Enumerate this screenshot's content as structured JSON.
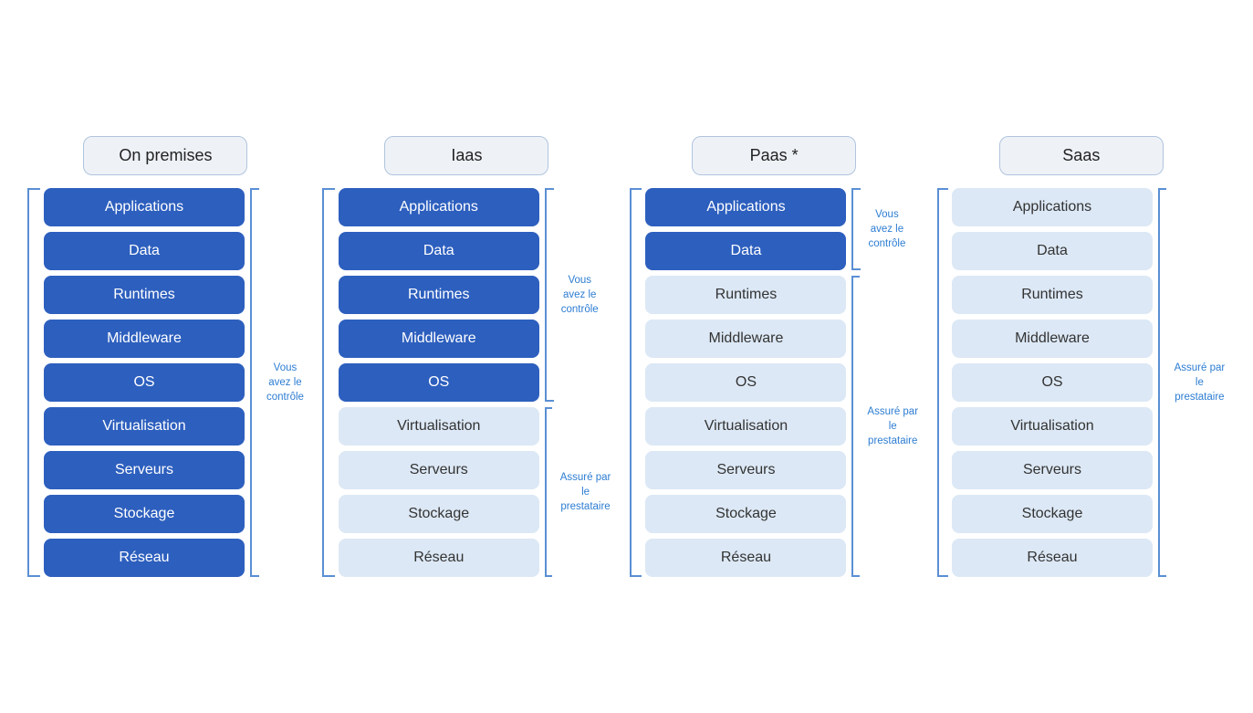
{
  "columns": [
    {
      "id": "on-premises",
      "header": "On premises",
      "items": [
        {
          "label": "Applications",
          "active": true
        },
        {
          "label": "Data",
          "active": true
        },
        {
          "label": "Runtimes",
          "active": true
        },
        {
          "label": "Middleware",
          "active": true
        },
        {
          "label": "OS",
          "active": true
        },
        {
          "label": "Virtualisation",
          "active": true
        },
        {
          "label": "Serveurs",
          "active": true
        },
        {
          "label": "Stockage",
          "active": true
        },
        {
          "label": "Réseau",
          "active": true
        }
      ],
      "bracket_label": "Vous\navez le\ncontrôle",
      "bracket_items_count": 9,
      "bracket_side": "right"
    },
    {
      "id": "iaas",
      "header": "Iaas",
      "groups": [
        {
          "bracket_label": "Vous\navez le\ncontrôle",
          "items": [
            {
              "label": "Applications",
              "active": true
            },
            {
              "label": "Data",
              "active": true
            },
            {
              "label": "Runtimes",
              "active": true
            },
            {
              "label": "Middleware",
              "active": true
            },
            {
              "label": "OS",
              "active": true
            }
          ]
        },
        {
          "bracket_label": "Assuré par le\nprestataire",
          "items": [
            {
              "label": "Virtualisation",
              "active": false
            },
            {
              "label": "Serveurs",
              "active": false
            },
            {
              "label": "Stockage",
              "active": false
            },
            {
              "label": "Réseau",
              "active": false
            }
          ]
        }
      ]
    },
    {
      "id": "paas",
      "header": "Paas *",
      "groups": [
        {
          "bracket_label": "Vous\navez le\ncontrôle",
          "items": [
            {
              "label": "Applications",
              "active": true
            },
            {
              "label": "Data",
              "active": true
            }
          ]
        },
        {
          "bracket_label": "Assuré par le\nprestataire",
          "items": [
            {
              "label": "Runtimes",
              "active": false
            },
            {
              "label": "Middleware",
              "active": false
            },
            {
              "label": "OS",
              "active": false
            },
            {
              "label": "Virtualisation",
              "active": false
            },
            {
              "label": "Serveurs",
              "active": false
            },
            {
              "label": "Stockage",
              "active": false
            },
            {
              "label": "Réseau",
              "active": false
            }
          ]
        }
      ]
    },
    {
      "id": "saas",
      "header": "Saas",
      "items": [
        {
          "label": "Applications",
          "active": false
        },
        {
          "label": "Data",
          "active": false
        },
        {
          "label": "Runtimes",
          "active": false
        },
        {
          "label": "Middleware",
          "active": false
        },
        {
          "label": "OS",
          "active": false
        },
        {
          "label": "Virtualisation",
          "active": false
        },
        {
          "label": "Serveurs",
          "active": false
        },
        {
          "label": "Stockage",
          "active": false
        },
        {
          "label": "Réseau",
          "active": false
        }
      ],
      "bracket_label": "Assuré par le\nprestataire",
      "bracket_side": "right"
    }
  ]
}
